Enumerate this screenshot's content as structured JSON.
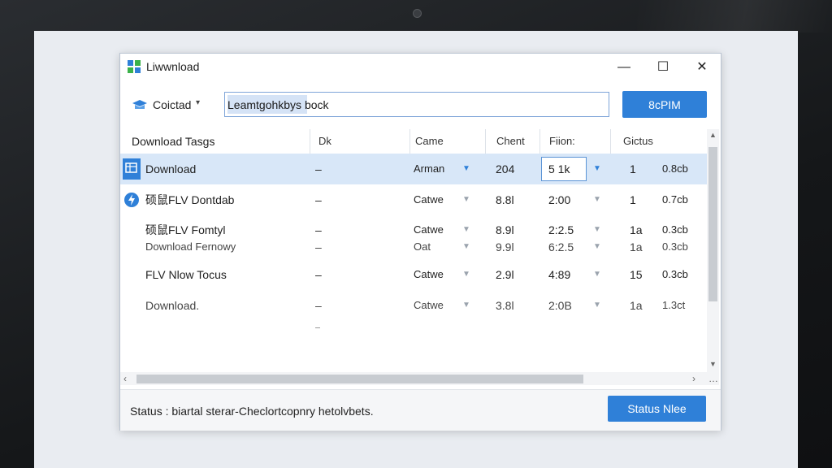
{
  "window": {
    "title": "Liwwnload",
    "minimize_glyph": "—",
    "maximize_glyph": "☐",
    "close_glyph": "✕"
  },
  "toolbar": {
    "location_label": "Coictad",
    "location_caret": "▾",
    "search_value": "Leamtgohkbys bock",
    "primary_button": "8cPIM"
  },
  "columns": [
    "Download Tasgs",
    "Dk",
    "Came",
    "Chent",
    "Fiion:",
    "Gictus"
  ],
  "rows": [
    {
      "name": "Download",
      "c2": "–",
      "c3": "Arman",
      "c4": "204",
      "c5": "5 1k",
      "c6": "1",
      "c7": "0.8cb",
      "icon": "list-icon",
      "selected": true
    },
    {
      "name": "硕鼠FLV Dontdab",
      "c2": "–",
      "c3": "Catwe",
      "c4": "8.8l",
      "c5": "2:00",
      "c6": "1",
      "c7": "0.7cb",
      "icon": "bolt-icon",
      "selected": false
    },
    {
      "name": "硕鼠FLV Fomtyl",
      "c2": "–",
      "c3": "Catwe",
      "c4": "8.9l",
      "c5": "2:2.5",
      "c6": "1a",
      "c7": "0.3cb",
      "icon": "",
      "selected": false
    },
    {
      "name": "Download Fernowy",
      "c2": "–",
      "c3": "Oat",
      "c4": "9.9l",
      "c5": "6:2.5",
      "c6": "1a",
      "c7": "0.3cb",
      "icon": "",
      "selected": false
    },
    {
      "name": "FLV Nlow Tocus",
      "c2": "–",
      "c3": "Catwe",
      "c4": "2.9l",
      "c5": "4:89",
      "c6": "15",
      "c7": "0.3cb",
      "icon": "",
      "selected": false
    },
    {
      "name": "Download.",
      "c2": "–",
      "c3": "Catwe",
      "c4": "3.8l",
      "c5": "2:0B",
      "c6": "1a",
      "c7": "1.3ct",
      "icon": "",
      "selected": false
    }
  ],
  "status": {
    "text": "Status : biartal sterar-Checlortcopnry hetolvbets.",
    "button": "Status Nlee"
  },
  "colors": {
    "accent": "#2f80d8",
    "selected_row": "#d8e7f8"
  }
}
